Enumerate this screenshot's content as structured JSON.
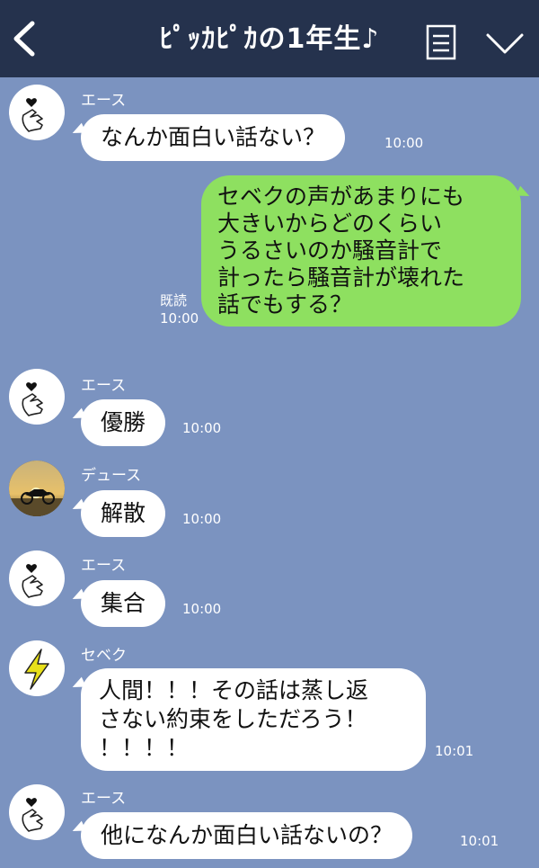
{
  "header": {
    "title": "ﾋﾟｯｶﾋﾟｶの1年生♪",
    "back_icon": "chevron-left-icon",
    "menu_icon": "list-icon",
    "dropdown_icon": "chevron-down-icon"
  },
  "colors": {
    "header_bg": "#25324d",
    "chat_bg": "#7b93c0",
    "incoming_bubble": "#ffffff",
    "outgoing_bubble": "#8ee060"
  },
  "messages": [
    {
      "sender": "エース",
      "text": "なんか面白い話ない？",
      "time": "10:00",
      "avatar": "heart-hand-icon"
    },
    {
      "sender": "",
      "text": "セベクの声があまりにも\n大きいからどのくらい\nうるさいのか騒音計で\n計ったら騒音計が壊れた\n話でもする？",
      "time": "10:00",
      "read": "既読",
      "outgoing": true
    },
    {
      "sender": "エース",
      "text": "優勝",
      "time": "10:00",
      "avatar": "heart-hand-icon"
    },
    {
      "sender": "デュース",
      "text": "解散",
      "time": "10:00",
      "avatar": "motorcycle-sunset-photo"
    },
    {
      "sender": "エース",
      "text": "集合",
      "time": "10:00",
      "avatar": "heart-hand-icon"
    },
    {
      "sender": "セベク",
      "text": "人間！！！その話は蒸し返\nさない約束をしただろう！\n！！！！",
      "time": "10:01",
      "avatar": "lightning-bolt-icon"
    },
    {
      "sender": "エース",
      "text": "他になんか面白い話ないの？",
      "time": "10:01",
      "avatar": "heart-hand-icon"
    }
  ]
}
